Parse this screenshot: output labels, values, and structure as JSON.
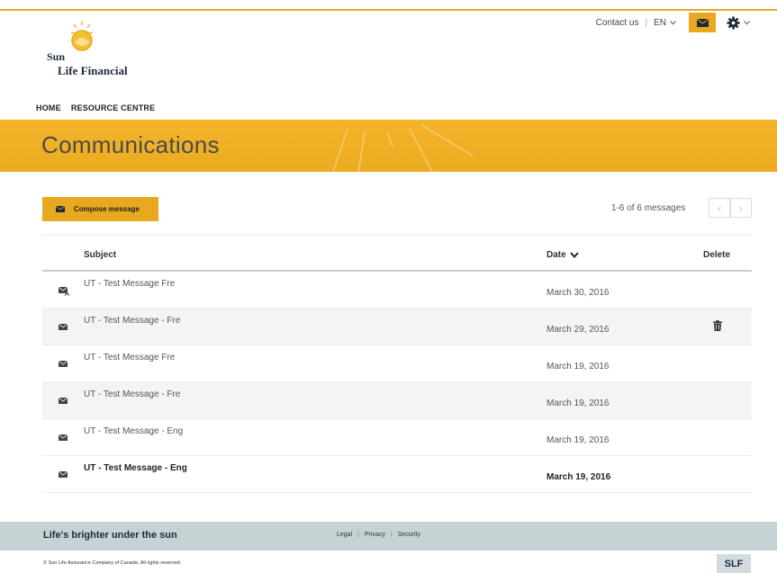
{
  "header": {
    "contact_label": "Contact us",
    "language": "EN",
    "logo_word_sun": "Sun",
    "logo_words_rest": "Life Financial"
  },
  "nav": {
    "items": [
      "HOME",
      "RESOURCE CENTRE"
    ]
  },
  "banner": {
    "title": "Communications"
  },
  "toolbar": {
    "compose_label": "Compose message",
    "pager_text": "1-6 of 6 messages",
    "prev_glyph": "‹",
    "next_glyph": "›"
  },
  "table": {
    "columns": {
      "subject": "Subject",
      "date": "Date",
      "delete": "Delete"
    },
    "rows": [
      {
        "subject": "UT - Test Message Fre",
        "date": "March 30, 2016",
        "icon": "mail-replied-icon",
        "unread": false,
        "delete": false
      },
      {
        "subject": "UT - Test Message - Fre",
        "date": "March 29, 2016",
        "icon": "mail-icon",
        "unread": false,
        "delete": true
      },
      {
        "subject": "UT - Test Message Fre",
        "date": "March 19, 2016",
        "icon": "mail-icon",
        "unread": false,
        "delete": false
      },
      {
        "subject": "UT - Test Message - Fre",
        "date": "March 19, 2016",
        "icon": "mail-icon",
        "unread": false,
        "delete": false
      },
      {
        "subject": "UT - Test Message - Eng",
        "date": "March 19, 2016",
        "icon": "mail-icon",
        "unread": false,
        "delete": false
      },
      {
        "subject": "UT - Test Message - Eng",
        "date": "March 19, 2016",
        "icon": "mail-icon",
        "unread": true,
        "delete": false
      }
    ]
  },
  "footer": {
    "tagline": "Life's brighter under the sun",
    "links": [
      "Legal",
      "Privacy",
      "Security"
    ],
    "copyright": "© Sun Life Assurance Company of Canada. All rights reserved.",
    "badge": "SLF"
  },
  "colors": {
    "accent": "#e8a820",
    "banner": "#f0b026",
    "footer": "#c5d3d5",
    "navy": "#1d2a3a"
  }
}
